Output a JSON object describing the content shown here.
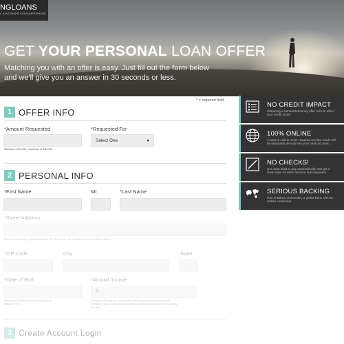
{
  "header": {
    "logo_main": "NGLOANS",
    "logo_sub": "A SANTANDER CONSUMER BRAND",
    "title_regular_1": "GET ",
    "title_bold": "YOUR PERSONAL",
    "title_regular_2": " LOAN OFFER",
    "subtitle": "Matching you with an offer is easy. Just fill out the form below and we'll give you an answer in 30 seconds or less."
  },
  "form": {
    "required_note": "* = required field",
    "offer_info": {
      "step": "1",
      "title": "OFFER INFO",
      "amount_label": "*Amount Requested",
      "amount_value": "",
      "amount_hint": "Minimum of $1,000, maximum of $30,000",
      "requested_for_label": "*Requested For",
      "requested_for_value": "Select One"
    },
    "personal_info": {
      "step": "2",
      "title": "PERSONAL INFO",
      "first_name_label": "*First Name",
      "mi_label": "MI",
      "last_name_label": "*Last Name",
      "street_label": "*Street Address",
      "street_hint": "Please provide your physical address. P.O. Boxes are not considered an acceptable address.",
      "zip_label": "*ZIP Code",
      "city_label": "City",
      "state_label": "State",
      "dob_label": "*Date of Birth",
      "dob_hint_1": "Date of birth format should be entered as",
      "dob_hint_2": "MM/DD/YYYY",
      "income_label": "*Annual Income",
      "income_prefix": "$",
      "income_hint_1": "Alimony, child support, or separate maintenance income need not be",
      "income_hint_2": "revealed if you do not choose to have it considered as a basis for repaying",
      "income_hint_3": "this loan"
    },
    "account": {
      "step": "3",
      "title": "Create Account Login"
    }
  },
  "sidebar": {
    "items": [
      {
        "title": "NO CREDIT IMPACT",
        "text": "Obtaining a SantanderMoney offer will not affect your credit score.",
        "icon": "list-icon"
      },
      {
        "title": "100% ONLINE",
        "text": "A branch visit is never required and the funds will be deposited directly into your bank account.",
        "icon": "globe-icon"
      },
      {
        "title": "NO CHECKS!",
        "text": "Use auto-draft to pay automatically and get a lower rate! All rates assume auto-payment.",
        "icon": "no-check-icon"
      },
      {
        "title": "SERIOUS BACKING",
        "text": "Part of Banco Santander, a global bank with 66 million customers.",
        "icon": "world-map-icon"
      }
    ]
  },
  "colors": {
    "accent": "#7fc9c0",
    "sidebar_bg": "#333333",
    "field_bg": "#ececec"
  }
}
